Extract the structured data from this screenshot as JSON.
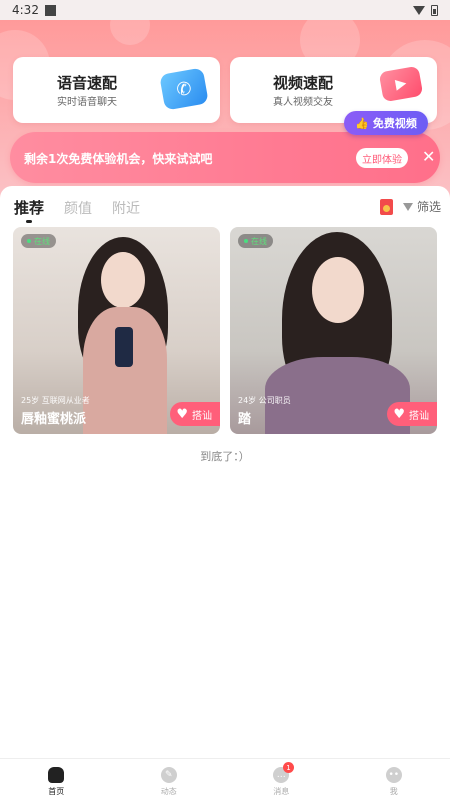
{
  "status_bar": {
    "time": "4:32"
  },
  "quick_match": {
    "voice": {
      "title": "语音速配",
      "subtitle": "实时语音聊天"
    },
    "video": {
      "title": "视频速配",
      "subtitle": "真人视频交友"
    },
    "free_video_badge": "免费视频"
  },
  "promo_banner": {
    "text": "剩余1次免费体验机会，快来试试吧",
    "button": "立即体验"
  },
  "tabs": [
    "推荐",
    "颜值",
    "附近"
  ],
  "filter_label": "筛选",
  "profiles": [
    {
      "status": "在线",
      "meta": "25岁 互联网从业者",
      "name": "唇釉蜜桃派",
      "action": "搭讪"
    },
    {
      "status": "在线",
      "meta": "24岁 公司职员",
      "name": "踏",
      "action": "搭讪"
    }
  ],
  "end_text": "到底了：）",
  "bottom_nav": {
    "items": [
      "首页",
      "动态",
      "消息",
      "我"
    ],
    "message_badge": "1"
  },
  "colors": {
    "accent": "#ff5f7a",
    "promo": "#ff7a90",
    "free_badge": "#7c5cf6"
  }
}
